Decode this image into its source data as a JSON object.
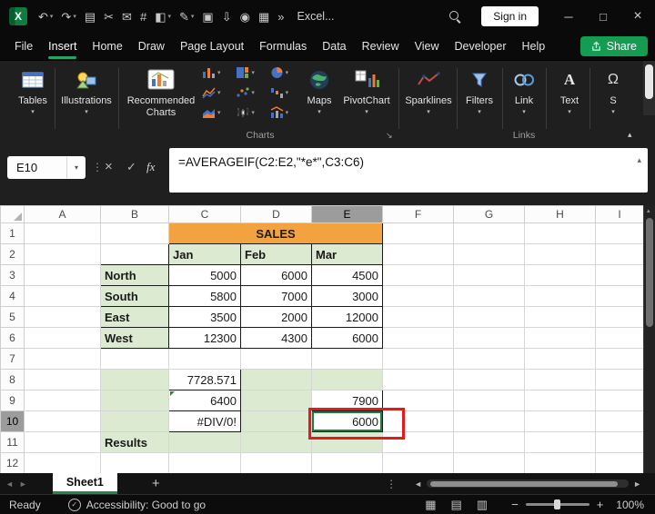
{
  "icons": {
    "dropdown": "▾",
    "collapse": "▴",
    "dots": "⋮",
    "cancel": "×",
    "confirm": "✓",
    "minimize": "─",
    "maximize": "□",
    "close": "×",
    "scroll_left": "◄",
    "scroll_right": "►",
    "scroll_up": "▲",
    "view_normal": "▦",
    "view_layout": "▤",
    "view_break": "▥",
    "zoom_out": "−",
    "zoom_in": "+",
    "launcher": "↘",
    "accessibility_check": "✓"
  },
  "titlebar": {
    "app_title": "Excel...",
    "sign_in_label": "Sign in",
    "qat": [
      {
        "name": "undo-icon",
        "glyph": "↶",
        "chev": true
      },
      {
        "name": "redo-icon",
        "glyph": "↷",
        "chev": true
      },
      {
        "name": "clipboard-icon",
        "glyph": "▤"
      },
      {
        "name": "cut-icon",
        "glyph": "✂"
      },
      {
        "name": "mail-icon",
        "glyph": "✉"
      },
      {
        "name": "number-format-icon",
        "glyph": "#"
      },
      {
        "name": "fill-color-icon",
        "glyph": "◧",
        "chev": true
      },
      {
        "name": "pen-icon",
        "glyph": "✎",
        "chev": true
      },
      {
        "name": "copy-icon",
        "glyph": "▣"
      },
      {
        "name": "save-icon",
        "glyph": "⇩"
      },
      {
        "name": "camera-icon",
        "glyph": "◉"
      },
      {
        "name": "table-icon",
        "glyph": "▦"
      },
      {
        "name": "more-commands-icon",
        "glyph": "»"
      }
    ]
  },
  "menubar": {
    "items": [
      {
        "label": "File"
      },
      {
        "label": "Insert",
        "active": true
      },
      {
        "label": "Home"
      },
      {
        "label": "Draw"
      },
      {
        "label": "Page Layout"
      },
      {
        "label": "Formulas"
      },
      {
        "label": "Data"
      },
      {
        "label": "Review"
      },
      {
        "label": "View"
      },
      {
        "label": "Developer"
      },
      {
        "label": "Help"
      }
    ],
    "share_label": "Share"
  },
  "ribbon": {
    "buttons": {
      "tables": "Tables",
      "illustrations": "Illustrations",
      "recommended": "Recommended Charts",
      "maps": "Maps",
      "pivotchart": "PivotChart",
      "sparklines": "Sparklines",
      "filters": "Filters",
      "link": "Link",
      "text": "Text",
      "symbols": "S"
    },
    "groups": {
      "charts": "Charts",
      "links": "Links"
    }
  },
  "formula_bar": {
    "name_box": "E10",
    "fx_label": "fx",
    "formula": "=AVERAGEIF(C2:E2,\"*e*\",C3:C6)"
  },
  "grid": {
    "columns": [
      "A",
      "B",
      "C",
      "D",
      "E",
      "F",
      "G",
      "H",
      "I"
    ],
    "rows": [
      "1",
      "2",
      "3",
      "4",
      "5",
      "6",
      "7",
      "8",
      "9",
      "10",
      "11",
      "12"
    ],
    "selected_column": "E",
    "selected_row": "10",
    "active_cell": "E10",
    "cells": [
      {
        "c": "C",
        "r": "1",
        "text": "SALES",
        "span": 3,
        "cls": "orange bold center border"
      },
      {
        "c": "B",
        "r": "2",
        "text": "",
        "cls": "border"
      },
      {
        "c": "C",
        "r": "2",
        "text": "Jan",
        "cls": "green bold border"
      },
      {
        "c": "D",
        "r": "2",
        "text": "Feb",
        "cls": "green bold border"
      },
      {
        "c": "E",
        "r": "2",
        "text": "Mar",
        "cls": "green bold border"
      },
      {
        "c": "B",
        "r": "3",
        "text": "North",
        "cls": "green bold border"
      },
      {
        "c": "C",
        "r": "3",
        "text": "5000",
        "cls": "num border"
      },
      {
        "c": "D",
        "r": "3",
        "text": "6000",
        "cls": "num border"
      },
      {
        "c": "E",
        "r": "3",
        "text": "4500",
        "cls": "num border"
      },
      {
        "c": "B",
        "r": "4",
        "text": "South",
        "cls": "green bold border"
      },
      {
        "c": "C",
        "r": "4",
        "text": "5800",
        "cls": "num border"
      },
      {
        "c": "D",
        "r": "4",
        "text": "7000",
        "cls": "num border"
      },
      {
        "c": "E",
        "r": "4",
        "text": "3000",
        "cls": "num border"
      },
      {
        "c": "B",
        "r": "5",
        "text": "East",
        "cls": "green bold border"
      },
      {
        "c": "C",
        "r": "5",
        "text": "3500",
        "cls": "num border"
      },
      {
        "c": "D",
        "r": "5",
        "text": "2000",
        "cls": "num border"
      },
      {
        "c": "E",
        "r": "5",
        "text": "12000",
        "cls": "num border"
      },
      {
        "c": "B",
        "r": "6",
        "text": "West",
        "cls": "green bold border"
      },
      {
        "c": "C",
        "r": "6",
        "text": "12300",
        "cls": "num border"
      },
      {
        "c": "D",
        "r": "6",
        "text": "4300",
        "cls": "num border"
      },
      {
        "c": "E",
        "r": "6",
        "text": "6000",
        "cls": "num border"
      },
      {
        "c": "B",
        "r": "8",
        "text": "",
        "cls": "green"
      },
      {
        "c": "C",
        "r": "8",
        "text": "7728.571",
        "cls": "num border"
      },
      {
        "c": "D",
        "r": "8",
        "text": "",
        "cls": "green"
      },
      {
        "c": "E",
        "r": "8",
        "text": "",
        "cls": "green"
      },
      {
        "c": "B",
        "r": "9",
        "text": "",
        "cls": "green"
      },
      {
        "c": "C",
        "r": "9",
        "text": "6400",
        "cls": "num border flag"
      },
      {
        "c": "D",
        "r": "9",
        "text": "",
        "cls": "green"
      },
      {
        "c": "E",
        "r": "9",
        "text": "7900",
        "cls": "num border"
      },
      {
        "c": "B",
        "r": "10",
        "text": "",
        "cls": "green"
      },
      {
        "c": "C",
        "r": "10",
        "text": "#DIV/0!",
        "cls": "num border"
      },
      {
        "c": "D",
        "r": "10",
        "text": "",
        "cls": "green"
      },
      {
        "c": "E",
        "r": "10",
        "text": "6000",
        "cls": "num border active"
      },
      {
        "c": "B",
        "r": "11",
        "text": "Results",
        "cls": "green bold"
      },
      {
        "c": "C",
        "r": "11",
        "text": "",
        "cls": "green"
      },
      {
        "c": "D",
        "r": "11",
        "text": "",
        "cls": "green"
      },
      {
        "c": "E",
        "r": "11",
        "text": "",
        "cls": "green"
      }
    ]
  },
  "tabbar": {
    "sheet_name": "Sheet1",
    "add_sheet": "+"
  },
  "statusbar": {
    "ready": "Ready",
    "accessibility": "Accessibility: Good to go",
    "zoom_level": "100%"
  }
}
